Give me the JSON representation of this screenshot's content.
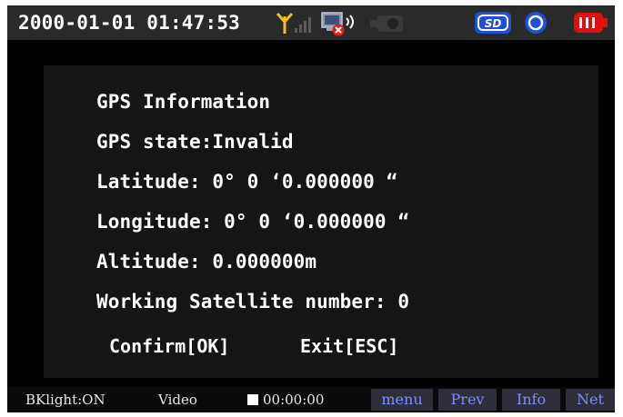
{
  "status_bar": {
    "datetime": "2000-01-01 01:47:53",
    "icons": [
      "signal-antenna-icon",
      "network-disconnected-icon",
      "camera-icon",
      "sd-card-icon",
      "record-disc-icon",
      "battery-icon"
    ],
    "sd_label": "SD"
  },
  "gps_panel": {
    "title": "GPS Information",
    "state": "GPS state:Invalid",
    "latitude": "Latitude: 0° 0 ‘0.000000 “",
    "longitude": "Longitude: 0° 0 ‘0.000000 “",
    "altitude": "Altitude: 0.000000m",
    "satellites": "Working Satellite number: 0",
    "confirm_label": "Confirm[OK]",
    "exit_label": "Exit[ESC]"
  },
  "bottom_bar": {
    "backlight": "BKlight:ON",
    "mode": "Video",
    "timer": "00:00:00",
    "soft_keys": [
      "menu",
      "Prev",
      "Info",
      "Net"
    ]
  },
  "colors": {
    "background": "#000000",
    "text": "#ffffff",
    "antenna": "#f0c020",
    "sd_blue": "#1f4fd8",
    "battery_red": "#e01010",
    "soft_key_text": "#7f8cff"
  }
}
